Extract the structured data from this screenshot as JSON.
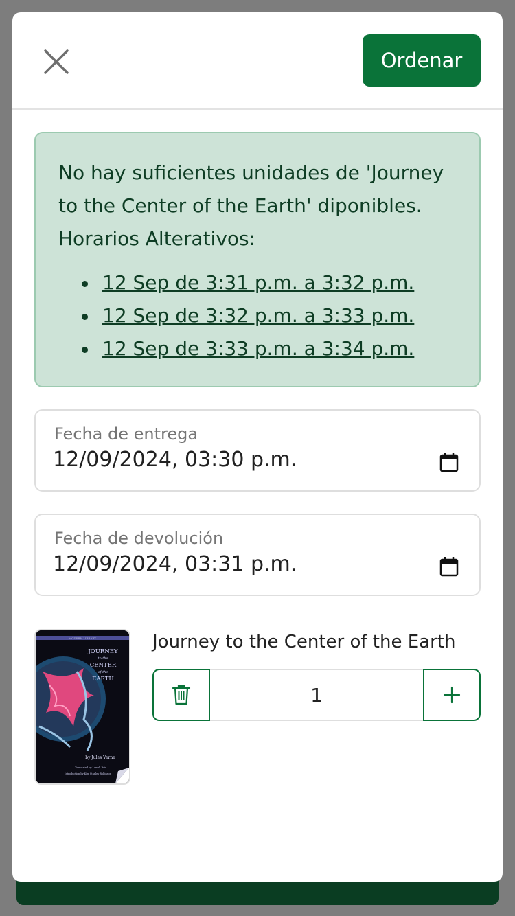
{
  "header": {
    "order_label": "Ordenar"
  },
  "alert": {
    "message": "No hay suficientes unidades de 'Journey to the Center of the Earth' diponibles. Horarios Alterativos:",
    "slots": [
      "12 Sep de 3:31 p.m. a 3:32 p.m.",
      "12 Sep de 3:32 p.m. a 3:33 p.m.",
      "12 Sep de 3:33 p.m. a 3:34 p.m."
    ]
  },
  "fields": {
    "delivery": {
      "label": "Fecha de entrega",
      "value": "12/09/2024, 03:30 p.m."
    },
    "return": {
      "label": "Fecha de devolución",
      "value": "12/09/2024, 03:31 p.m."
    }
  },
  "item": {
    "title": "Journey to the Center of the Earth",
    "quantity": "1",
    "cover": {
      "series": "MODERN LIBRARY",
      "title_line1": "JOURNEY",
      "title_line2": "to the",
      "title_line3": "CENTER",
      "title_line4": "of the",
      "title_line5": "EARTH",
      "author": "by Jules Verne",
      "translator": "Translated by Lowell Bair",
      "intro": "Introduction by Kim Stanley Robinson"
    }
  },
  "colors": {
    "primary": "#0a7339",
    "alert_bg": "#cde3d7",
    "alert_text": "#0e3d24"
  },
  "icons": {
    "close": "close-icon",
    "calendar": "calendar-icon",
    "trash": "trash-icon",
    "plus": "plus-icon"
  }
}
